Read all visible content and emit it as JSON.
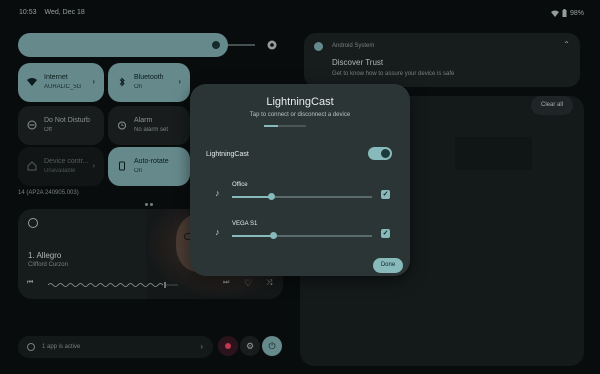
{
  "status": {
    "time": "10:53",
    "date": "Wed, Dec 18",
    "battery": "98%"
  },
  "tiles": [
    {
      "label": "Internet",
      "sub": "AURALIC_5G",
      "state": "on"
    },
    {
      "label": "Bluetooth",
      "sub": "On",
      "state": "on"
    },
    {
      "label": "Do Not Disturb",
      "sub": "Off",
      "state": "off"
    },
    {
      "label": "Alarm",
      "sub": "No alarm set",
      "state": "off"
    },
    {
      "label": "Device contr...",
      "sub": "Unavailable",
      "state": "dim"
    },
    {
      "label": "Auto-rotate",
      "sub": "On",
      "state": "on"
    }
  ],
  "build": "14 (AP2A 240905.003)",
  "media": {
    "title": "1. Allegro",
    "artist": "Clifford Curzon",
    "progress": 0.9
  },
  "active": {
    "label": "1 app is active"
  },
  "notification": {
    "app": "Android System",
    "title": "Discover Trust",
    "body": "Get to know how to assure your device is safe"
  },
  "clear_all": "Clear all",
  "dialog": {
    "title": "LightningCast",
    "subtitle": "Tap to connect or disconnect a device",
    "main_label": "LightningCast",
    "main_enabled": true,
    "devices": [
      {
        "name": "Office",
        "volume": 0.28,
        "checked": true
      },
      {
        "name": "VEGA S1",
        "volume": 0.29,
        "checked": true
      }
    ],
    "done": "Done"
  },
  "colors": {
    "accent": "#88b9bb",
    "surface": "#2c3536",
    "background": "#0d1112"
  }
}
